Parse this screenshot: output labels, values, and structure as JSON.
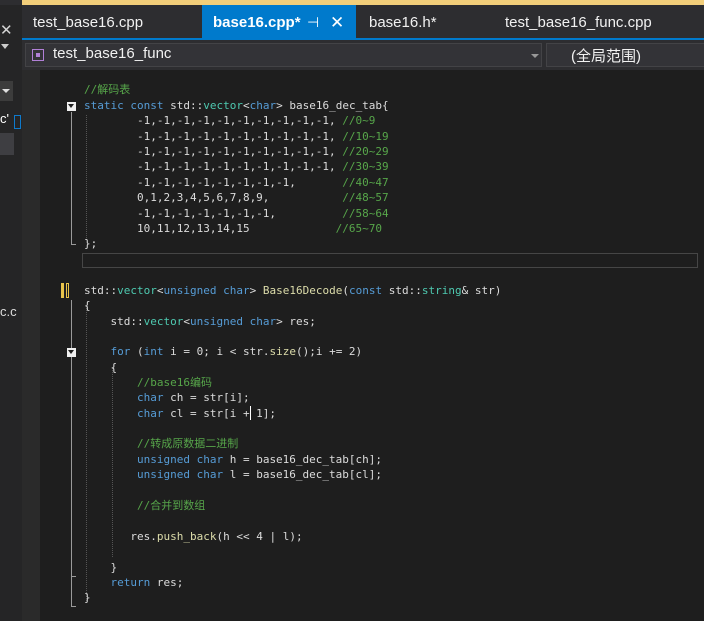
{
  "left_panel": {
    "close_glyph": "✕",
    "item_1": "c'",
    "item_2": "c.c"
  },
  "tabs": [
    {
      "label": "test_base16.cpp",
      "active": false
    },
    {
      "label": "base16.cpp*",
      "active": true,
      "pin": "⊣",
      "close": "✕"
    },
    {
      "label": "base16.h*",
      "active": false
    },
    {
      "label": "test_base16_func.cpp",
      "active": false
    }
  ],
  "navbar": {
    "project": "test_base16_func",
    "scope": "(全局范围)"
  },
  "colors": {
    "accent": "#007acc",
    "editor_bg": "#1e1e1e",
    "comment": "#57a64a",
    "keyword": "#569cd6",
    "type": "#4ec9b0",
    "function": "#dcdcaa"
  },
  "code": {
    "l1": [
      [
        "cm",
        "//解码表"
      ]
    ],
    "l2": [
      [
        "kw",
        "static const "
      ],
      [
        "id",
        "std::"
      ],
      [
        "ty",
        "vector"
      ],
      [
        "id",
        "<"
      ],
      [
        "kw",
        "char"
      ],
      [
        "id",
        "> base16_dec_tab{"
      ]
    ],
    "l3": [
      [
        "id",
        "        -1,-1,-1,-1,-1,-1,-1,-1,-1,-1, "
      ],
      [
        "cm",
        "//0~9"
      ]
    ],
    "l4": [
      [
        "id",
        "        -1,-1,-1,-1,-1,-1,-1,-1,-1,-1, "
      ],
      [
        "cm",
        "//10~19"
      ]
    ],
    "l5": [
      [
        "id",
        "        -1,-1,-1,-1,-1,-1,-1,-1,-1,-1, "
      ],
      [
        "cm",
        "//20~29"
      ]
    ],
    "l6": [
      [
        "id",
        "        -1,-1,-1,-1,-1,-1,-1,-1,-1,-1, "
      ],
      [
        "cm",
        "//30~39"
      ]
    ],
    "l7": [
      [
        "id",
        "        -1,-1,-1,-1,-1,-1,-1,-1,       "
      ],
      [
        "cm",
        "//40~47"
      ]
    ],
    "l8": [
      [
        "id",
        "        0,1,2,3,4,5,6,7,8,9,           "
      ],
      [
        "cm",
        "//48~57"
      ]
    ],
    "l9": [
      [
        "id",
        "        -1,-1,-1,-1,-1,-1,-1,          "
      ],
      [
        "cm",
        "//58~64"
      ]
    ],
    "l10": [
      [
        "id",
        "        10,11,12,13,14,15             "
      ],
      [
        "cm",
        "//65~70"
      ]
    ],
    "l11": [
      [
        "id",
        "};"
      ]
    ],
    "l13": [
      [
        "id",
        "std::"
      ],
      [
        "ty",
        "vector"
      ],
      [
        "id",
        "<"
      ],
      [
        "kw",
        "unsigned char"
      ],
      [
        "id",
        "> "
      ],
      [
        "fn",
        "Base16Decode"
      ],
      [
        "id",
        "("
      ],
      [
        "kw",
        "const "
      ],
      [
        "id",
        "std::"
      ],
      [
        "ty",
        "string"
      ],
      [
        "id",
        "& str)"
      ]
    ],
    "l14": [
      [
        "id",
        "{"
      ]
    ],
    "l15": [
      [
        "id",
        "    std::"
      ],
      [
        "ty",
        "vector"
      ],
      [
        "id",
        "<"
      ],
      [
        "kw",
        "unsigned char"
      ],
      [
        "id",
        "> res;"
      ]
    ],
    "l17": [
      [
        "kw",
        "    for "
      ],
      [
        "id",
        "("
      ],
      [
        "kw",
        "int "
      ],
      [
        "id",
        "i = 0; i < str."
      ],
      [
        "fn",
        "size"
      ],
      [
        "id",
        "();i += 2)"
      ]
    ],
    "l18": [
      [
        "id",
        "    {"
      ]
    ],
    "l19": [
      [
        "cm",
        "        //base16编码"
      ]
    ],
    "l20": [
      [
        "kw",
        "        char "
      ],
      [
        "id",
        "ch = str[i];"
      ]
    ],
    "l21": [
      [
        "kw",
        "        char "
      ],
      [
        "id",
        "cl = str[i + 1];"
      ]
    ],
    "l23": [
      [
        "cm",
        "        //转成原数据二进制"
      ]
    ],
    "l24": [
      [
        "kw",
        "        unsigned char "
      ],
      [
        "id",
        "h = base16_dec_tab[ch];"
      ]
    ],
    "l25": [
      [
        "kw",
        "        unsigned char "
      ],
      [
        "id",
        "l = base16_dec_tab[cl];"
      ]
    ],
    "l27": [
      [
        "cm",
        "        //合并到数组"
      ]
    ],
    "l29": [
      [
        "id",
        "       res."
      ],
      [
        "fn",
        "push_back"
      ],
      [
        "id",
        "(h << 4 | l);"
      ]
    ],
    "l31": [
      [
        "id",
        "    }"
      ]
    ],
    "l32": [
      [
        "kw",
        "    return "
      ],
      [
        "id",
        "res;"
      ]
    ],
    "l33": [
      [
        "id",
        "}"
      ]
    ]
  }
}
